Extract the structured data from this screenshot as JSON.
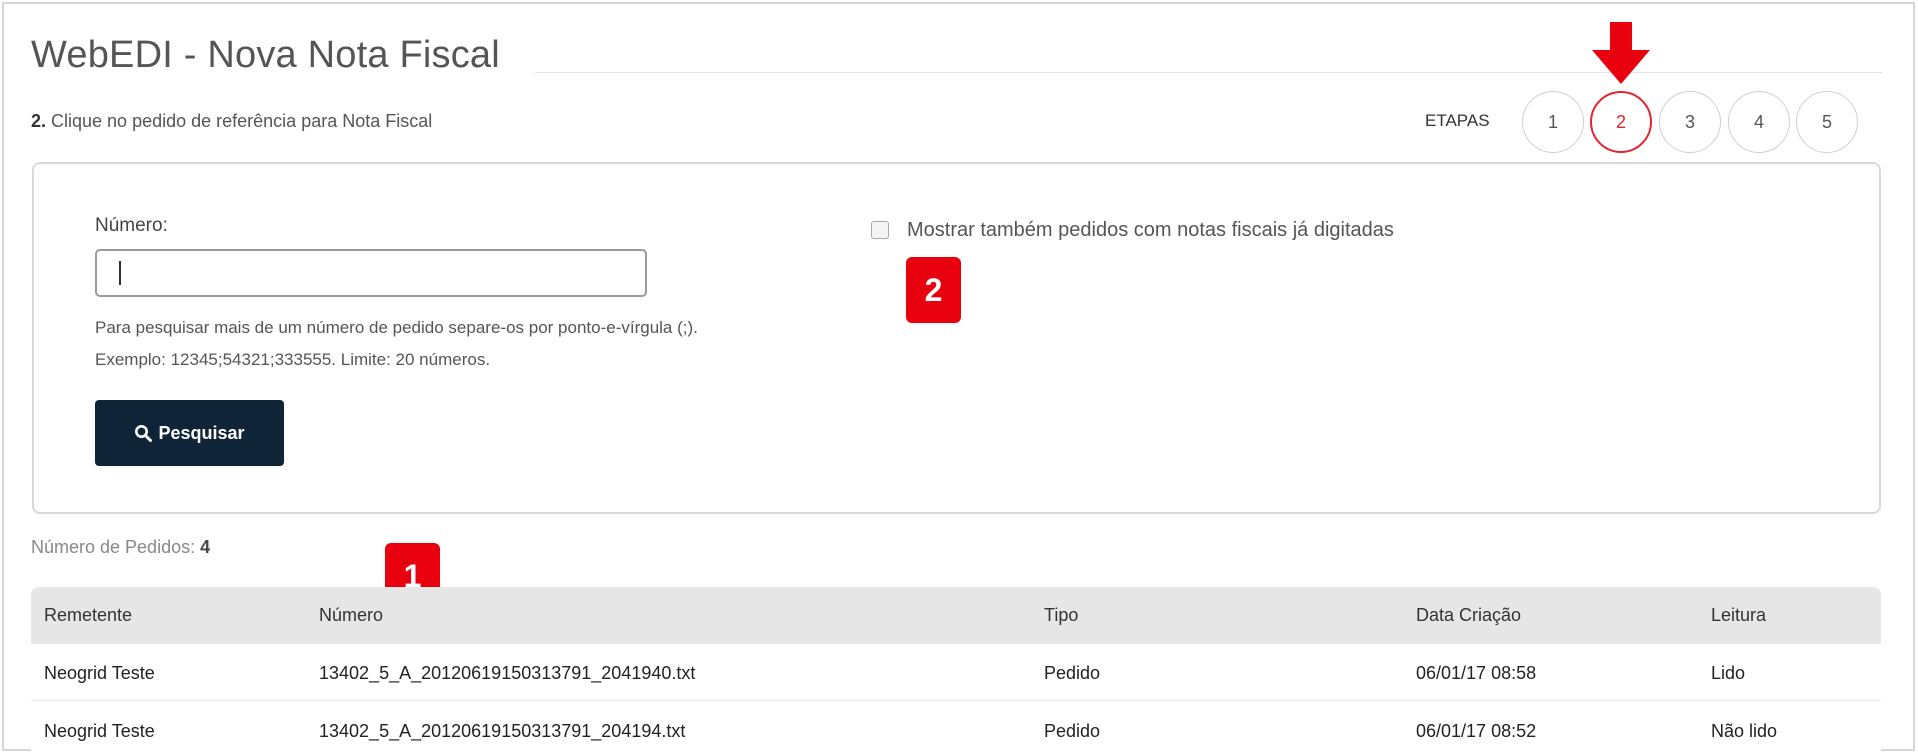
{
  "page": {
    "title": "WebEDI - Nova Nota Fiscal",
    "instruction_step": "2.",
    "instruction_text": " Clique no pedido de referência para Nota Fiscal"
  },
  "steps": {
    "label": "ETAPAS",
    "items": [
      "1",
      "2",
      "3",
      "4",
      "5"
    ],
    "active": "2",
    "active_color": "#e3232d"
  },
  "search": {
    "numero_label": "Número:",
    "numero_value": "",
    "hint_line1": "Para pesquisar mais de um número de pedido separe-os por ponto-e-vírgula (;).",
    "hint_line2": "Exemplo: 12345;54321;333555. Limite: 20 números.",
    "button_label": "Pesquisar",
    "button_icon": "search-icon",
    "checkbox_label": "Mostrar também pedidos com notas fiscais já digitadas",
    "checkbox_checked": false
  },
  "annotations": {
    "badge_1": "1",
    "badge_2": "2",
    "badge_color": "#e8000f",
    "arrow_icon": "arrow-down-icon"
  },
  "orders": {
    "count_label": "Número de Pedidos:",
    "count_value": "4",
    "columns": [
      "Remetente",
      "Número",
      "Tipo",
      "Data Criação",
      "Leitura"
    ],
    "rows": [
      [
        "Neogrid Teste",
        "13402_5_A_20120619150313791_2041940.txt",
        "Pedido",
        "06/01/17 08:58",
        "Lido"
      ],
      [
        "Neogrid Teste",
        "13402_5_A_20120619150313791_204194.txt",
        "Pedido",
        "06/01/17 08:52",
        "Não lido"
      ]
    ]
  },
  "colors": {
    "button_bg": "#0f2537",
    "table_header_bg": "#e6e6e6"
  }
}
